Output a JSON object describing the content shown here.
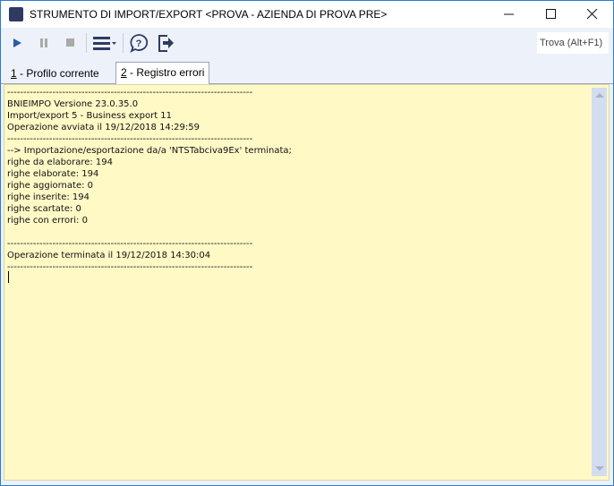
{
  "window": {
    "title": "STRUMENTO DI IMPORT/EXPORT <PROVA - AZIENDA DI PROVA PRE>",
    "app_icon_text": "B2"
  },
  "toolbar": {
    "find_label": "Trova (Alt+F1)"
  },
  "tabs": [
    {
      "key": "1",
      "label": " - Profilo corrente",
      "active": false
    },
    {
      "key": "2",
      "label": " - Registro errori",
      "active": true
    }
  ],
  "log": {
    "lines": [
      "----------------------------------------------------------------------------",
      "BNIEIMPO Versione 23.0.35.0",
      "Import/export 5 - Business export 11",
      "Operazione avviata il 19/12/2018 14:29:59",
      "----------------------------------------------------------------------------",
      "--> Importazione/esportazione da/a 'NTSTabciva9Ex' terminata;",
      "righe da elaborare: 194",
      "righe elaborate: 194",
      "righe aggiornate: 0",
      "righe inserite: 194",
      "righe scartate: 0",
      "righe con errori: 0",
      "",
      "----------------------------------------------------------------------------",
      "Operazione terminata il 19/12/2018 14:30:04",
      "----------------------------------------------------------------------------"
    ]
  }
}
